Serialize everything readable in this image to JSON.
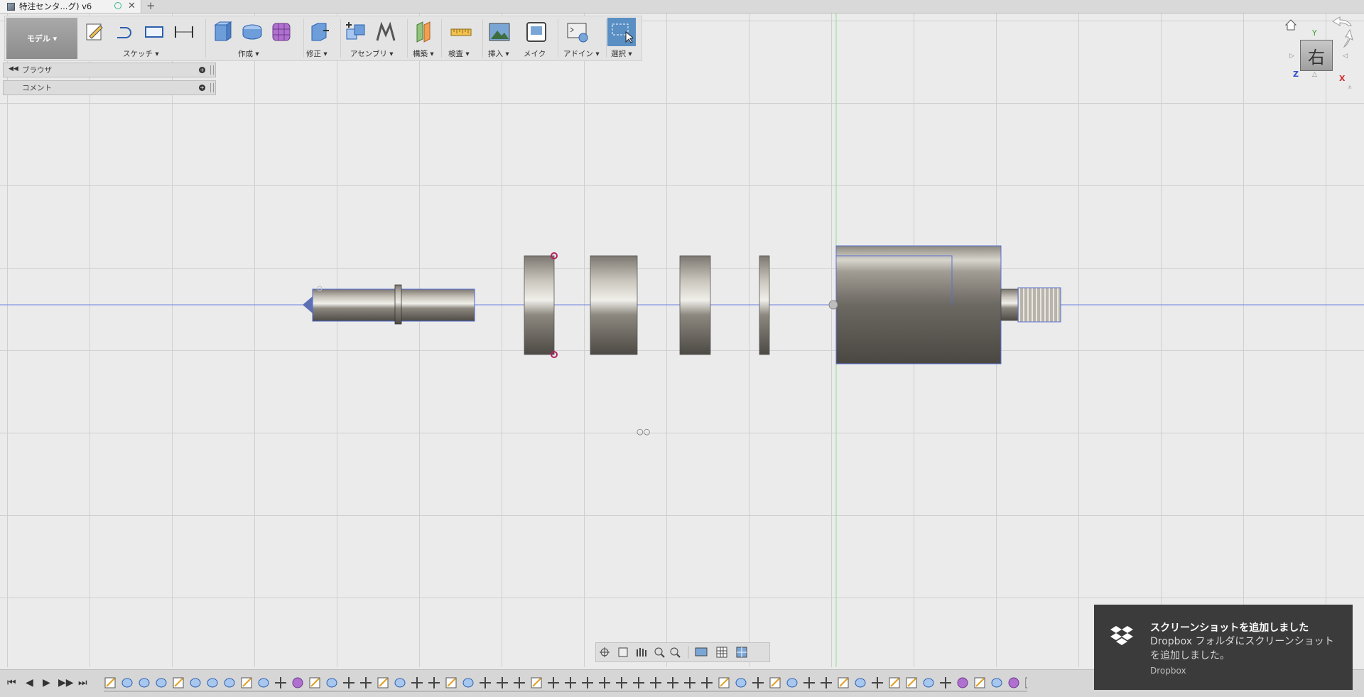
{
  "document_tab": {
    "title": "特注センタ...グ) v6",
    "icon": "cube-icon",
    "close": "✕",
    "new_tab": "+"
  },
  "workspace_button": "モデル ▾",
  "toolbar": {
    "groups": [
      {
        "label": "スケッチ ▾"
      },
      {
        "label": "作成 ▾"
      },
      {
        "label": "修正 ▾"
      },
      {
        "label": "アセンブリ ▾"
      },
      {
        "label": "構築 ▾"
      },
      {
        "label": "検査 ▾"
      },
      {
        "label": "挿入 ▾"
      },
      {
        "label": "メイク"
      },
      {
        "label": "アドイン ▾"
      },
      {
        "label": "選択 ▾"
      }
    ]
  },
  "panels": {
    "browser": "ブラウザ",
    "comment": "コメント",
    "add_symbol": "+"
  },
  "view_cube": {
    "face": "右",
    "axis_y": "Y",
    "axis_z": "Z",
    "axis_x": "X"
  },
  "origin_label": "○○",
  "toast": {
    "title": "スクリーンショットを追加しました",
    "body": "Dropbox フォルダにスクリーンショットを追加しました。",
    "source": "Dropbox"
  },
  "timeline": {
    "controls": [
      "⏮",
      "◀",
      "▶",
      "▶▶",
      "⏭"
    ]
  },
  "colors": {
    "accent_select": "#5a8fc4",
    "viewport_bg": "#ebebeb",
    "toast_bg": "#3b3b3b"
  }
}
